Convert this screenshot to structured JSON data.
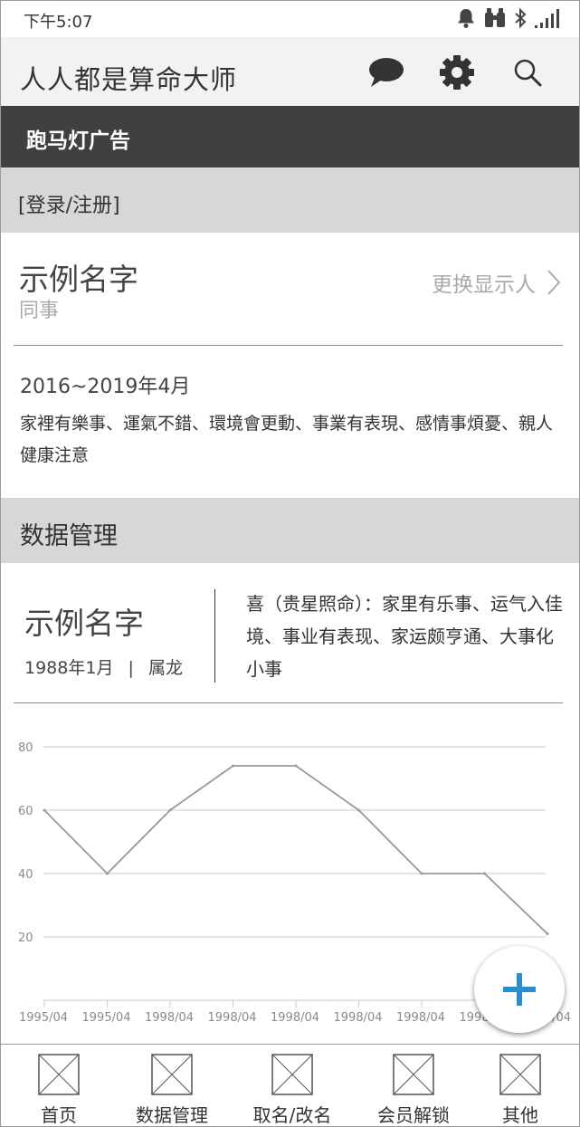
{
  "status_bar": {
    "time": "下午5:07",
    "icons": [
      "bell-icon",
      "binoculars-icon",
      "bluetooth-icon",
      "signal-icon"
    ]
  },
  "app_bar": {
    "title": "人人都是算命大师",
    "actions": [
      "chat-bubble-icon",
      "gear-icon",
      "search-icon"
    ]
  },
  "marquee": {
    "text": "跑马灯广告"
  },
  "login": {
    "text": "[登录/注册]"
  },
  "profile": {
    "name": "示例名字",
    "relation": "同事",
    "switch_label": "更换显示人"
  },
  "fortune": {
    "period": "2016~2019年4月",
    "description": "家裡有樂事、運氣不錯、環境會更動、事業有表現、感情事煩憂、親人健康注意"
  },
  "data_section": {
    "title": "数据管理"
  },
  "person": {
    "name": "示例名字",
    "birth": "1988年1月",
    "separator": "|",
    "zodiac": "属龙",
    "description": "喜（贵星照命）：家里有乐事、运气入佳境、事业有表现、家运颇亨通、大事化小事"
  },
  "chart_data": {
    "type": "line",
    "categories": [
      "1995/04",
      "1995/04",
      "1998/04",
      "1998/04",
      "1998/04",
      "1998/04",
      "1998/04",
      "1998/04",
      "1998/04"
    ],
    "values": [
      60,
      40,
      60,
      74,
      74,
      60,
      40,
      40,
      21
    ],
    "ylim": [
      0,
      80
    ],
    "yticks": [
      20,
      40,
      60,
      80
    ],
    "grid": true,
    "colors": {
      "line": "#999999",
      "grid": "#c8c8c8",
      "label": "#8a8a8a"
    }
  },
  "fab": {
    "icon": "plus-icon",
    "color": "#2b8cd4"
  },
  "bottom_nav": {
    "items": [
      {
        "label": "首页"
      },
      {
        "label": "数据管理"
      },
      {
        "label": "取名/改名"
      },
      {
        "label": "会员解锁"
      },
      {
        "label": "其他"
      }
    ]
  }
}
